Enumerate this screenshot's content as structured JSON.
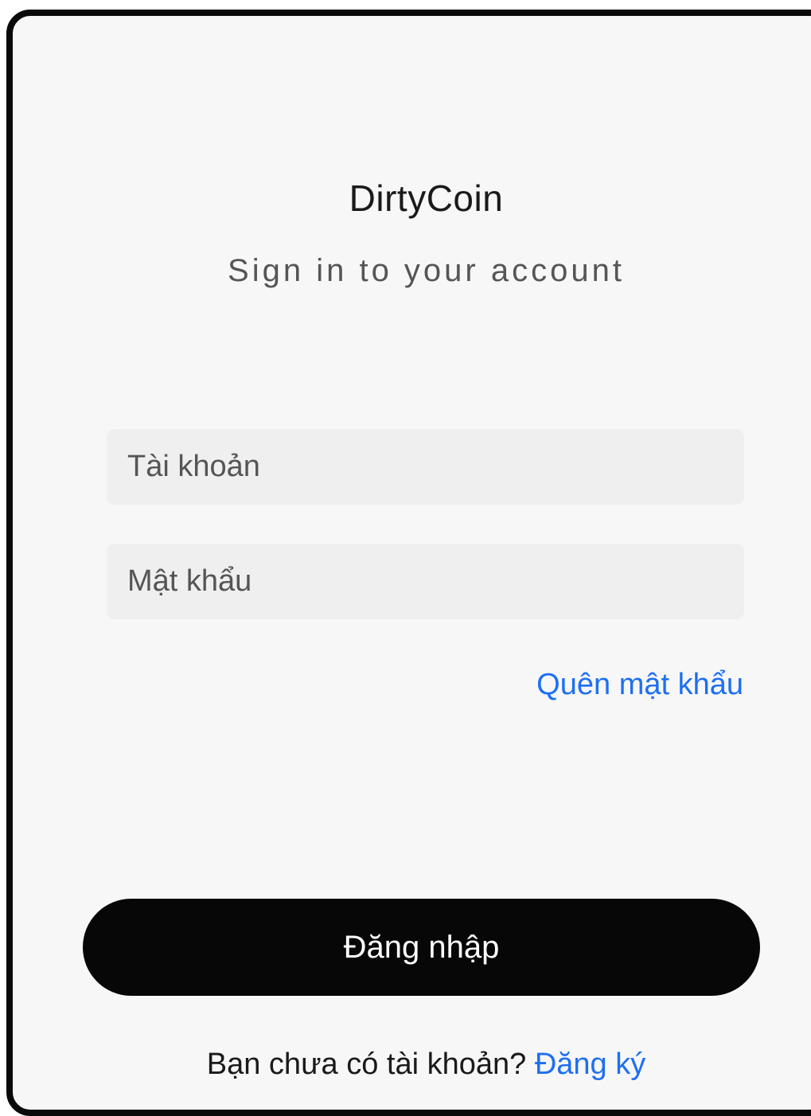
{
  "brand": {
    "name": "DirtyCoin"
  },
  "header": {
    "subtitle": "Sign in to your account"
  },
  "form": {
    "username": {
      "value": "",
      "placeholder": "Tài khoản"
    },
    "password": {
      "value": "",
      "placeholder": "Mật khẩu"
    },
    "forgot_password_label": "Quên mật khẩu",
    "submit_label": "Đăng nhập"
  },
  "footer": {
    "prompt": "Bạn chưa có tài khoản?",
    "signup_label": "Đăng ký"
  },
  "colors": {
    "card_background": "#f7f7f7",
    "input_background": "#efefef",
    "link": "#1e6ff2",
    "button_background": "#070707",
    "button_text": "#ffffff",
    "frame_border": "#0a0a0a"
  }
}
